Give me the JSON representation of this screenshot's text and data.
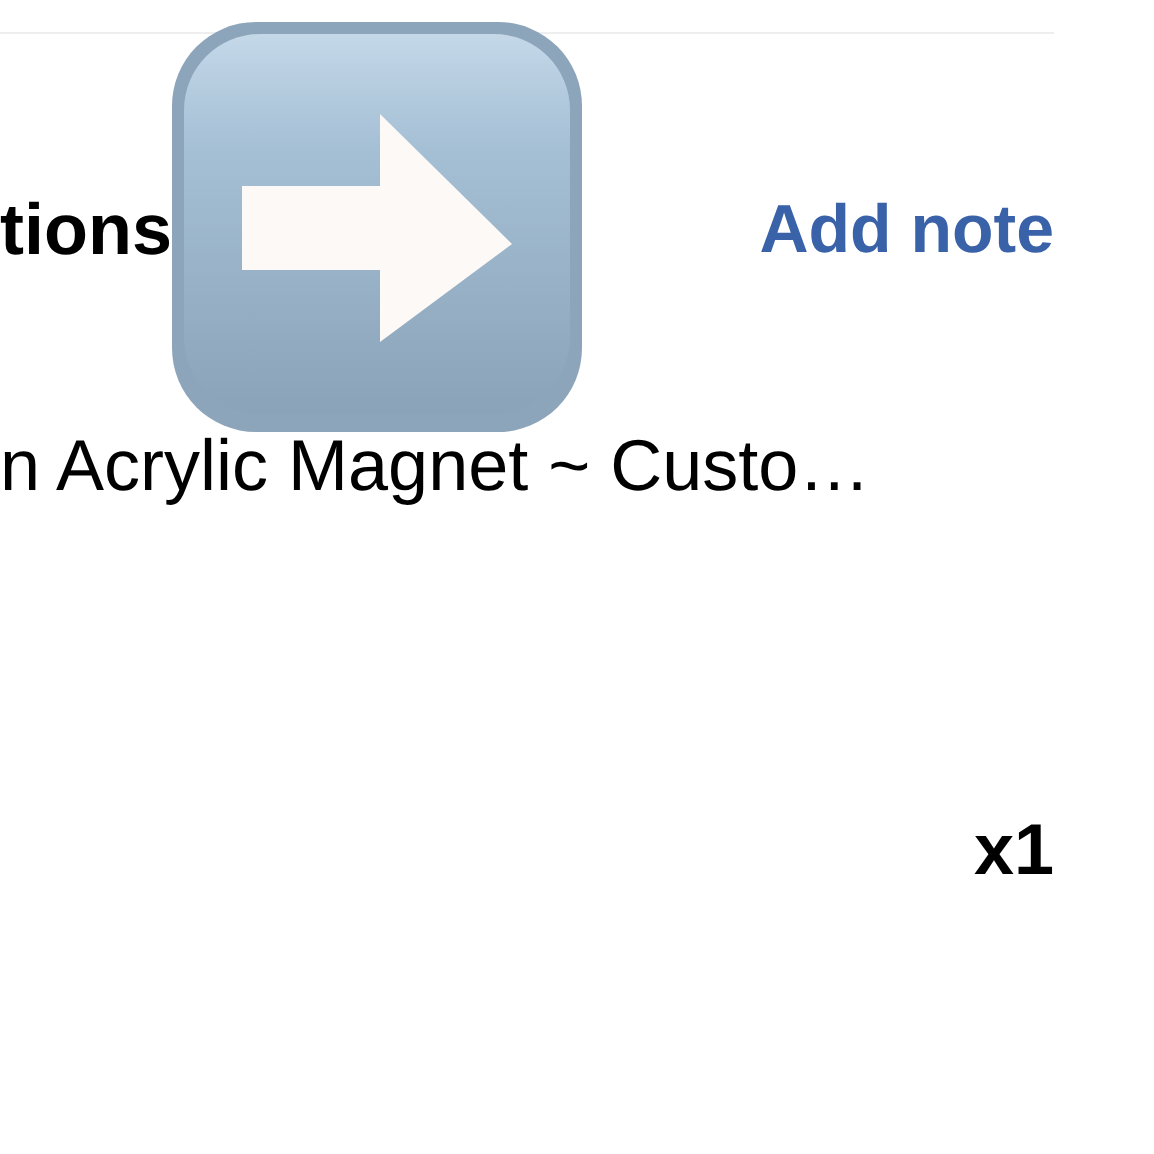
{
  "section": {
    "title": "tions",
    "action": "Add note"
  },
  "item": {
    "name": "n Acrylic Magnet ~ Custo…",
    "quantity": "x1"
  }
}
